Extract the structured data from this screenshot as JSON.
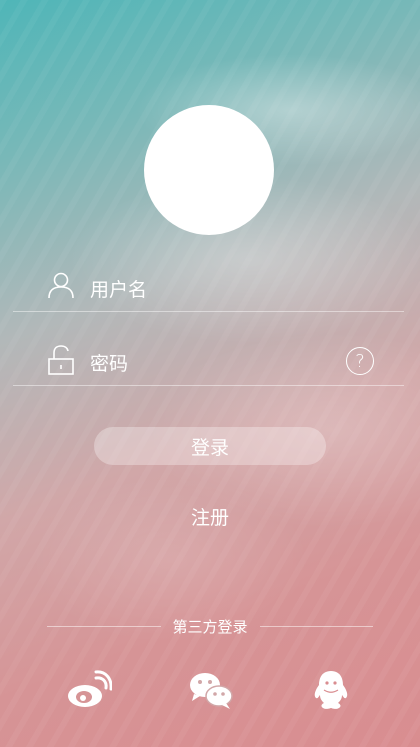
{
  "form": {
    "username_placeholder": "用户名",
    "password_placeholder": "密码",
    "help_symbol": "?"
  },
  "actions": {
    "login_label": "登录",
    "register_label": "注册"
  },
  "third_party": {
    "label": "第三方登录",
    "providers": [
      "weibo-icon",
      "wechat-icon",
      "qq-icon"
    ]
  }
}
